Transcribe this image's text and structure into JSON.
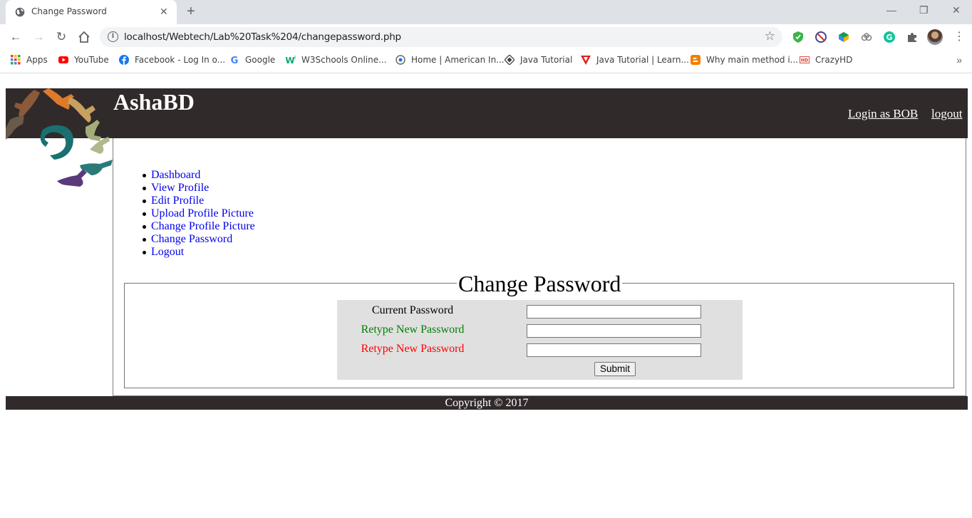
{
  "browser": {
    "tab_title": "Change Password",
    "url": "localhost/Webtech/Lab%20Task%204/changepassword.php",
    "bookmarks": [
      {
        "label": "Apps",
        "icon": "apps-grid-icon"
      },
      {
        "label": "YouTube",
        "icon": "youtube-icon"
      },
      {
        "label": "Facebook - Log In o...",
        "icon": "facebook-icon"
      },
      {
        "label": "Google",
        "icon": "google-icon"
      },
      {
        "label": "W3Schools Online...",
        "icon": "w3schools-icon"
      },
      {
        "label": "Home | American In...",
        "icon": "globe-icon"
      },
      {
        "label": "Java Tutorial",
        "icon": "diamond-icon"
      },
      {
        "label": "Java Tutorial | Learn...",
        "icon": "javatpoint-icon"
      },
      {
        "label": "Why main method i...",
        "icon": "blogger-icon"
      },
      {
        "label": "CrazyHD",
        "icon": "hd-icon"
      }
    ],
    "more_bookmarks": "»"
  },
  "site": {
    "title": "AshaBD",
    "header_links": {
      "login": "Login as BOB",
      "logout": "logout"
    },
    "nav": [
      "Dashboard",
      "View Profile",
      "Edit Profile",
      "Upload Profile Picture",
      "Change Profile Picture",
      "Change Password",
      "Logout"
    ],
    "form": {
      "legend": "Change Password",
      "fields": [
        {
          "label": "Current Password",
          "color": "#000000",
          "value": ""
        },
        {
          "label": "Retype New Password",
          "color": "#008000",
          "value": ""
        },
        {
          "label": "Retype New Password",
          "color": "#ff0000",
          "value": ""
        }
      ],
      "submit": "Submit"
    },
    "footer": "Copyright © 2017"
  },
  "colors": {
    "header_bg": "#312a2b",
    "link": "#0000ee",
    "form_bg": "#e0e0e0"
  }
}
